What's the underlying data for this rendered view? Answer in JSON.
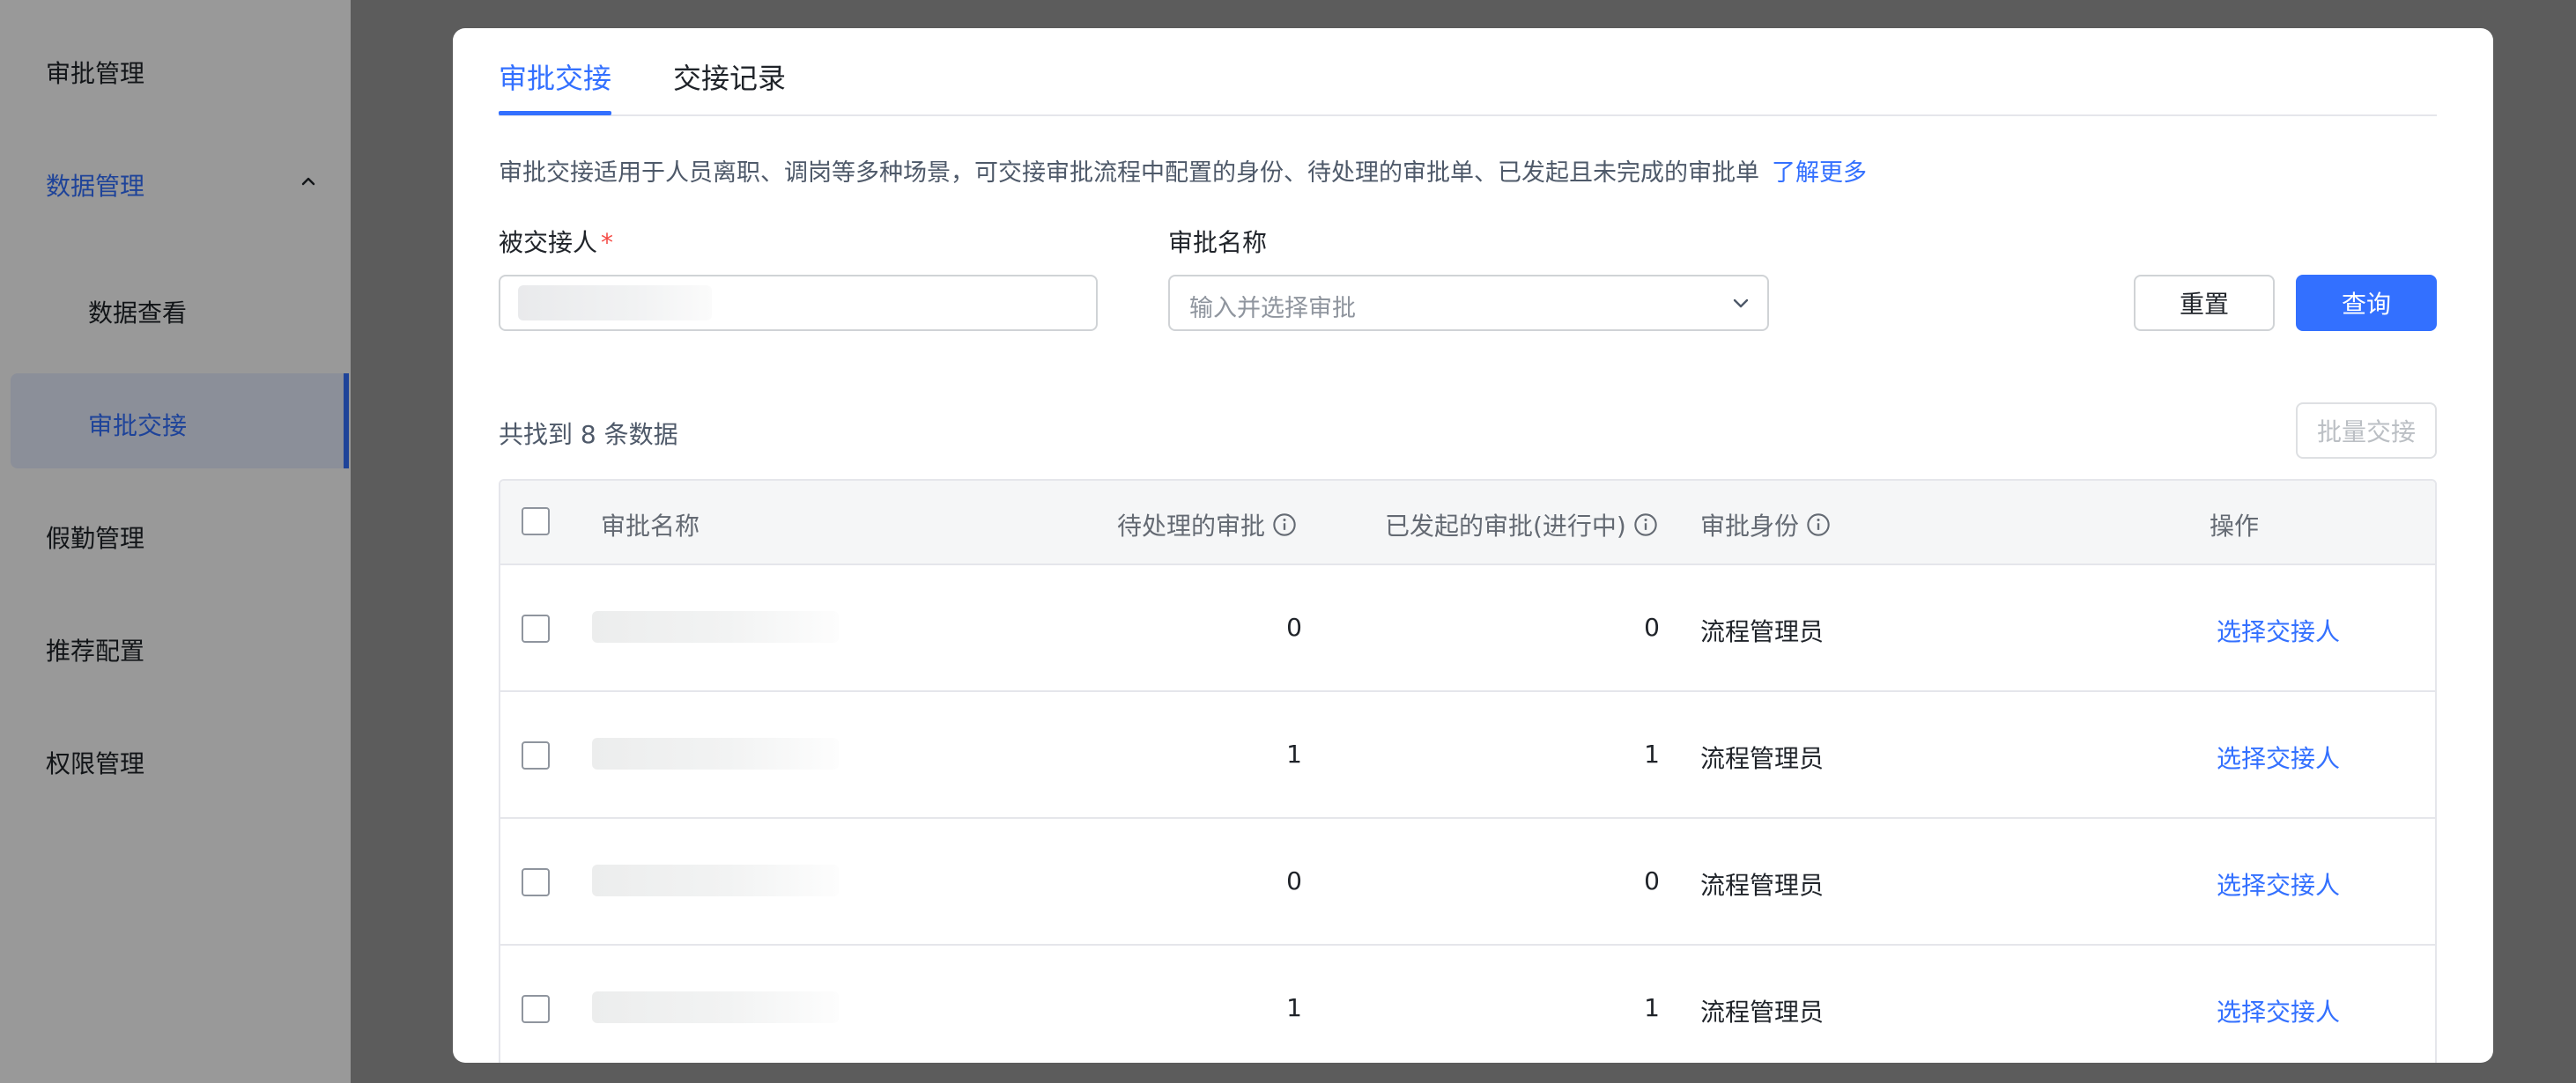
{
  "sidebar": {
    "items": [
      {
        "label": "审批管理"
      },
      {
        "label": "数据管理"
      },
      {
        "label": "数据查看"
      },
      {
        "label": "审批交接"
      },
      {
        "label": "假勤管理"
      },
      {
        "label": "推荐配置"
      },
      {
        "label": "权限管理"
      }
    ]
  },
  "modal": {
    "tabs": [
      {
        "label": "审批交接",
        "active": true
      },
      {
        "label": "交接记录",
        "active": false
      }
    ],
    "description": "审批交接适用于人员离职、调岗等多种场景，可交接审批流程中配置的身份、待处理的审批单、已发起且未完成的审批单",
    "learn_more": "了解更多",
    "form": {
      "handover_label": "被交接人",
      "required_mark": "*",
      "approval_name_label": "审批名称",
      "approval_name_placeholder": "输入并选择审批",
      "reset_label": "重置",
      "query_label": "查询"
    },
    "result_count": "共找到 8 条数据",
    "batch_label": "批量交接",
    "table": {
      "columns": [
        "审批名称",
        "待处理的审批",
        "已发起的审批(进行中)",
        "审批身份",
        "操作"
      ],
      "rows": [
        {
          "pending": "0",
          "initiated": "0",
          "role": "流程管理员",
          "action": "选择交接人"
        },
        {
          "pending": "1",
          "initiated": "1",
          "role": "流程管理员",
          "action": "选择交接人"
        },
        {
          "pending": "0",
          "initiated": "0",
          "role": "流程管理员",
          "action": "选择交接人"
        },
        {
          "pending": "1",
          "initiated": "1",
          "role": "流程管理员",
          "action": "选择交接人"
        }
      ]
    }
  },
  "colors": {
    "accent": "#3370ff",
    "required": "#f54a45",
    "overlay": "rgba(0,0,0,0.40)"
  },
  "icons": [
    "chevron-up-icon",
    "chevron-down-icon",
    "info-icon"
  ]
}
